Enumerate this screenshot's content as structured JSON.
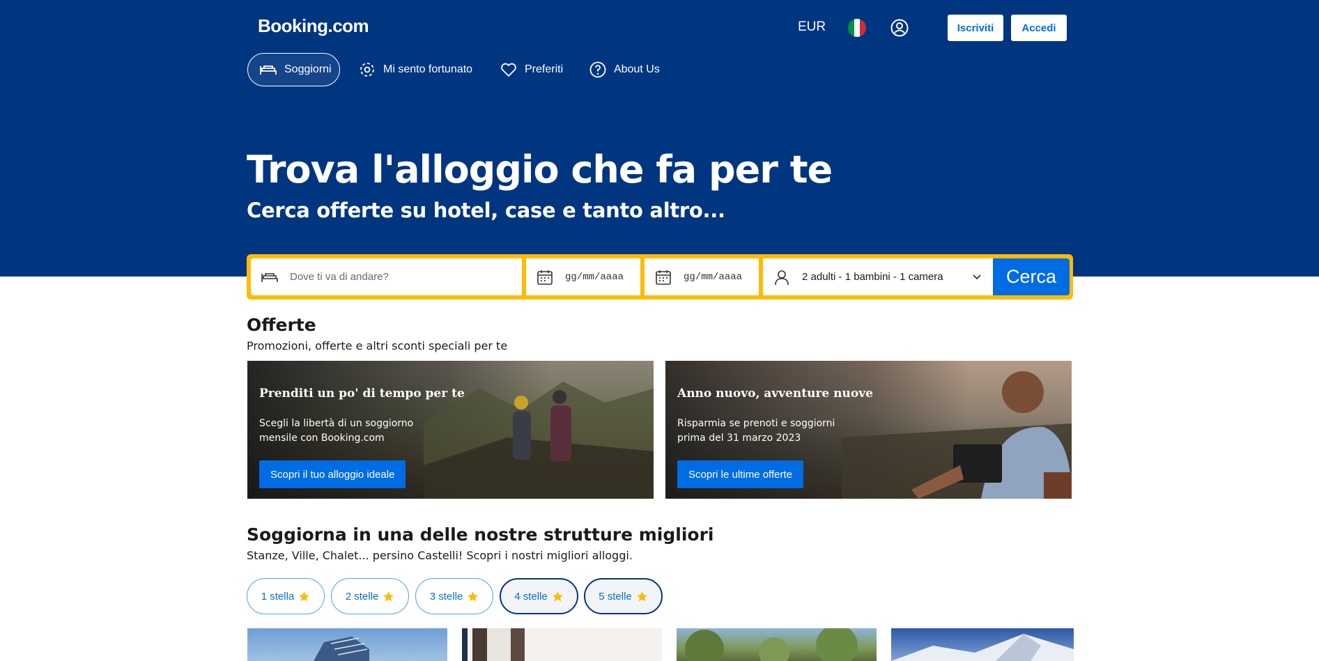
{
  "header": {
    "logo": "Booking.com",
    "currency": "EUR",
    "register_label": "Iscriviti",
    "login_label": "Accedi"
  },
  "nav": {
    "items": [
      {
        "label": "Soggiorni",
        "icon": "bed-icon",
        "active": true
      },
      {
        "label": "Mi sento fortunato",
        "icon": "gear-flower-icon",
        "active": false
      },
      {
        "label": "Preferiti",
        "icon": "heart-icon",
        "active": false
      },
      {
        "label": "About Us",
        "icon": "question-circle-icon",
        "active": false
      }
    ]
  },
  "hero": {
    "title": "Trova l'alloggio che fa per te",
    "subtitle": "Cerca offerte su hotel, case e tanto altro..."
  },
  "search": {
    "destination_placeholder": "Dove ti va di andare?",
    "checkin_placeholder": "gg/mm/aaaa",
    "checkout_placeholder": "gg/mm/aaaa",
    "guests_value": "2 adulti - 1 bambini - 1 camera",
    "button_label": "Cerca"
  },
  "offers": {
    "title": "Offerte",
    "subtitle": "Promozioni, offerte e altri sconti speciali per te",
    "cards": [
      {
        "heading": "Prenditi un po' di tempo per te",
        "text": "Scegli la libertà di un soggiorno mensile con Booking.com",
        "button": "Scopri il tuo alloggio ideale"
      },
      {
        "heading": "Anno nuovo, avventure nuove",
        "text": "Risparmia se prenoti e soggiorni prima del 31 marzo 2023",
        "button": "Scopri le ultime offerte"
      }
    ]
  },
  "best": {
    "title": "Soggiorna in una delle nostre strutture migliori",
    "subtitle": "Stanze, Ville, Chalet... persino Castelli! Scopri i nostri migliori alloggi.",
    "chips": [
      "1 stella",
      "2 stelle",
      "3 stelle",
      "4 stelle",
      "5 stelle"
    ]
  },
  "colors": {
    "brand_blue": "#003580",
    "action_blue": "#006ce4",
    "search_border": "#febb02",
    "star": "#febb02"
  }
}
